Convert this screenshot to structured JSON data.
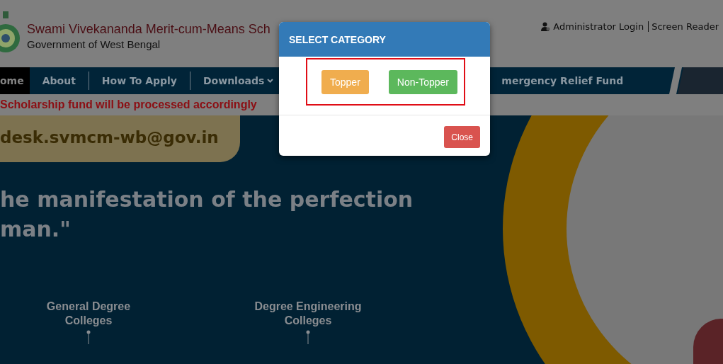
{
  "header": {
    "title": "Swami Vivekananda Merit-cum-Means Sch",
    "subtitle": "Government of West Bengal",
    "links": [
      "Administrator Login",
      "Screen Reader"
    ]
  },
  "nav": [
    {
      "label": "ome",
      "selected": true,
      "dropdown": false
    },
    {
      "label": "About",
      "selected": false,
      "dropdown": false
    },
    {
      "label": "How To Apply",
      "selected": false,
      "dropdown": false
    },
    {
      "label": "Downloads",
      "selected": false,
      "dropdown": true
    },
    {
      "label": "mergency Relief Fund",
      "selected": false,
      "dropdown": false
    }
  ],
  "ticker": "Scholarship fund will be processed accordingly",
  "hero": {
    "email": "desk.svmcm-wb@gov.in",
    "quote_lines": [
      "he manifestation of the perfection",
      "man.\""
    ],
    "colleges": [
      "General Degree Colleges",
      "Degree Engineering Colleges"
    ]
  },
  "modal": {
    "title": "SELECT CATEGORY",
    "options": [
      {
        "label": "Topper",
        "kind": "warning"
      },
      {
        "label": "Non-Topper",
        "kind": "success"
      }
    ],
    "footer_buttons": [
      {
        "label": "Close",
        "kind": "danger"
      }
    ]
  }
}
